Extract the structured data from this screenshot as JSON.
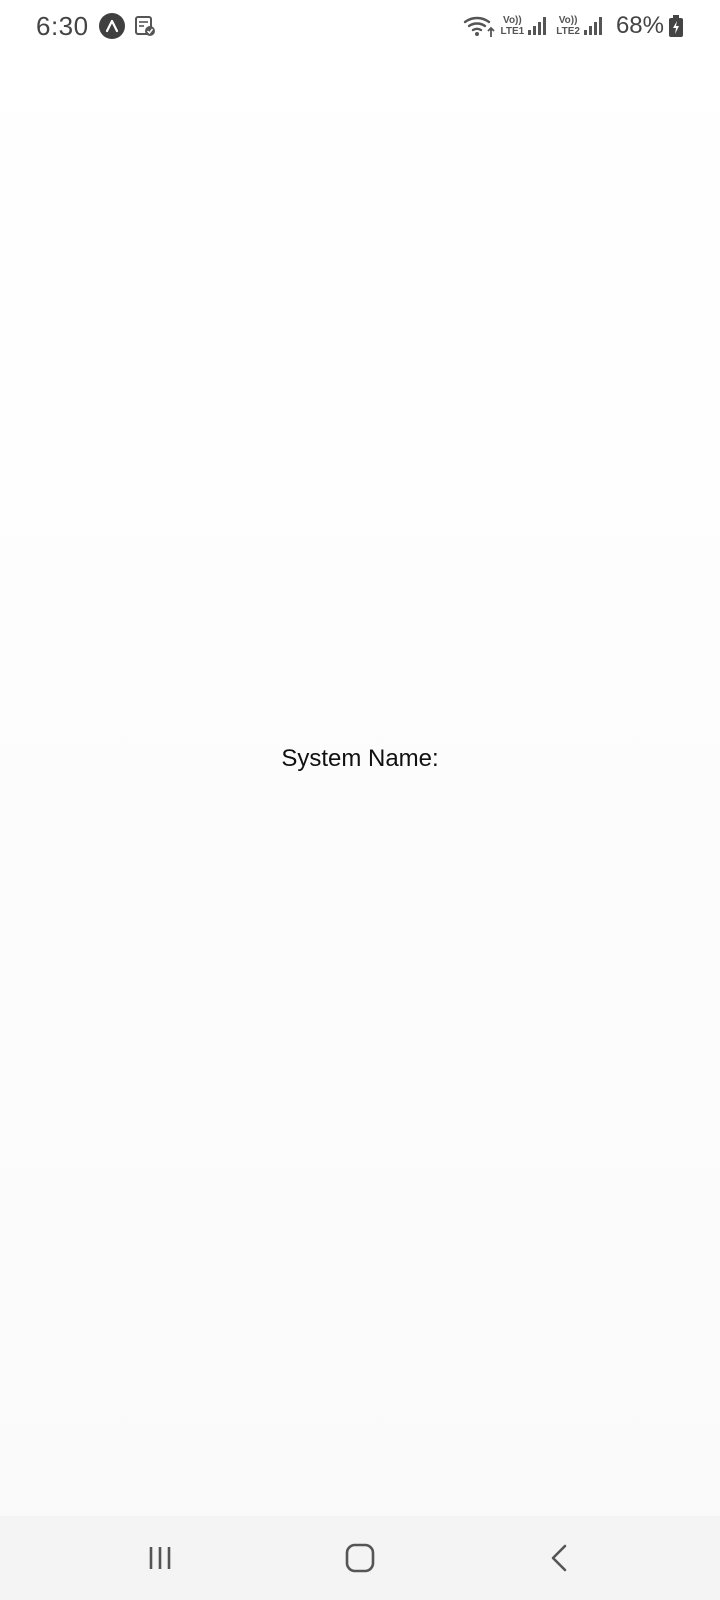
{
  "status_bar": {
    "time": "6:30",
    "volte1_top": "Vo))",
    "volte1_bottom": "LTE1",
    "volte2_top": "Vo))",
    "volte2_bottom": "LTE2",
    "battery": "68%"
  },
  "main": {
    "system_name_label": "System Name:"
  },
  "icons": {
    "app": "app-circle-icon",
    "note": "note-check-icon",
    "wifi": "wifi-icon",
    "signal": "signal-icon",
    "battery": "battery-icon",
    "recents": "recents-icon",
    "home": "home-icon",
    "back": "back-icon"
  },
  "colors": {
    "background": "#fdfdfd",
    "status_text": "#444444",
    "nav_background": "#f4f4f4"
  }
}
